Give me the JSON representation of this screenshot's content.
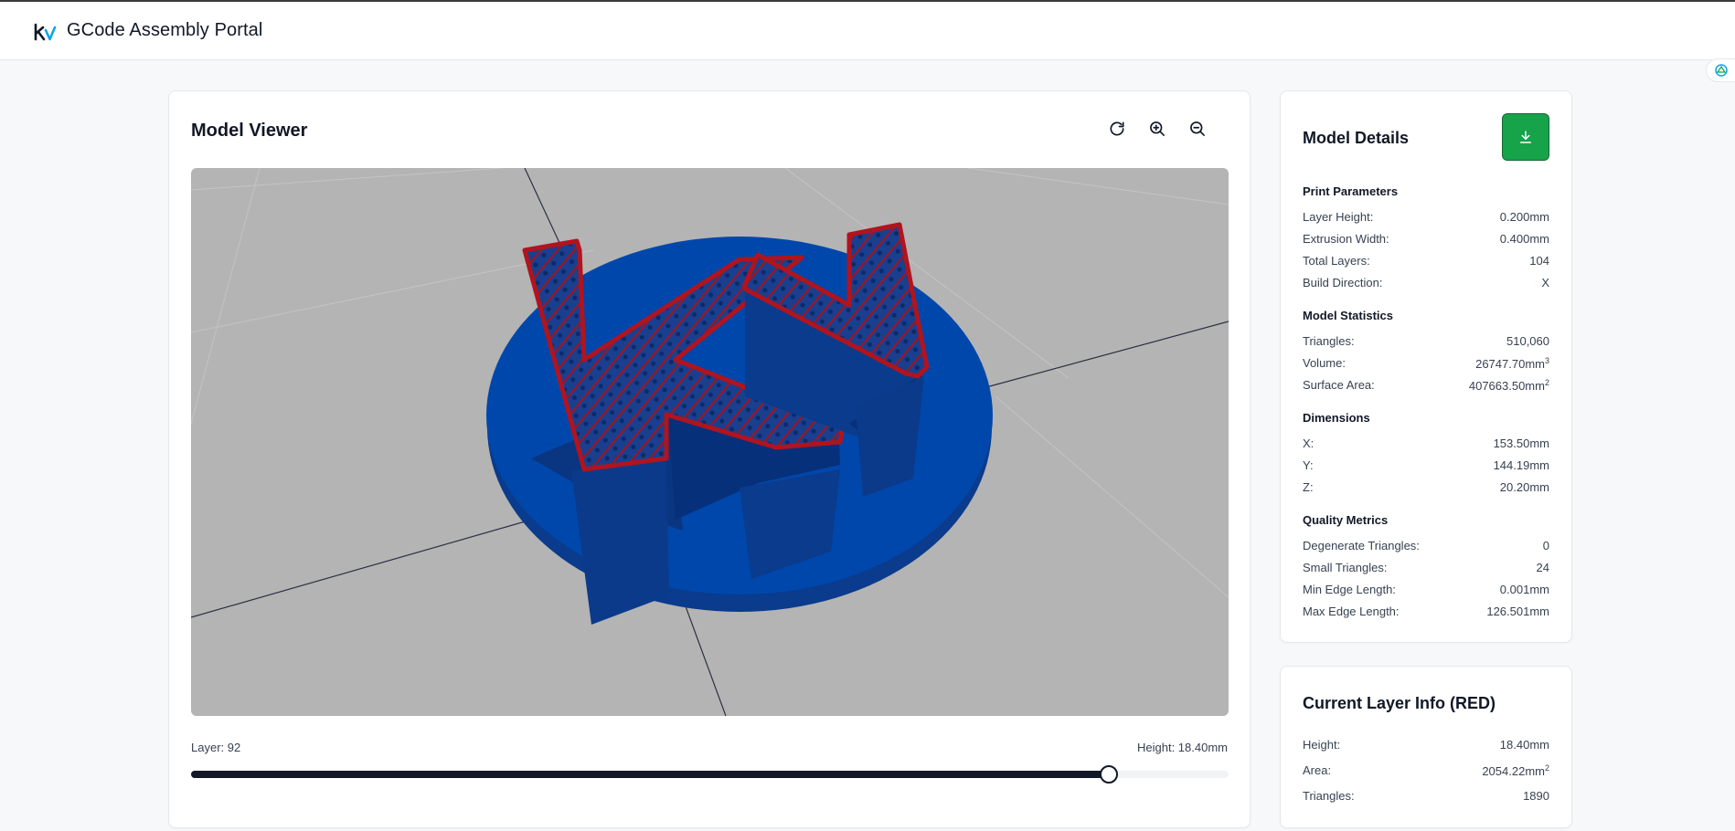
{
  "header": {
    "title": "GCode Assembly Portal",
    "logo_text": "kv"
  },
  "viewer": {
    "title": "Model Viewer",
    "tools": [
      {
        "name": "reset-view",
        "icon": "refresh-icon"
      },
      {
        "name": "zoom-in",
        "icon": "zoom-in-icon"
      },
      {
        "name": "zoom-out",
        "icon": "zoom-out-icon"
      }
    ],
    "layer_label": "Layer: 92",
    "height_label": "Height: 18.40mm",
    "slider": {
      "current_layer": 92,
      "total_layers": 104,
      "fraction": 0.885
    },
    "colors": {
      "viewport_bg": "#b4b4b4",
      "model": "#0047ab",
      "current_layer": "#b0141e"
    }
  },
  "details": {
    "title": "Model Details",
    "download_icon": "download-icon",
    "download_color": "#16a34a",
    "sections": [
      {
        "title": "Print Parameters",
        "rows": [
          {
            "label": "Layer Height:",
            "value": "0.200mm"
          },
          {
            "label": "Extrusion Width:",
            "value": "0.400mm"
          },
          {
            "label": "Total Layers:",
            "value": "104"
          },
          {
            "label": "Build Direction:",
            "value": "X"
          }
        ]
      },
      {
        "title": "Model Statistics",
        "rows": [
          {
            "label": "Triangles:",
            "value": "510,060"
          },
          {
            "label": "Volume:",
            "value": "26747.70mm",
            "unit_sup": "3"
          },
          {
            "label": "Surface Area:",
            "value": "407663.50mm",
            "unit_sup": "2"
          }
        ]
      },
      {
        "title": "Dimensions",
        "rows": [
          {
            "label": "X:",
            "value": "153.50mm"
          },
          {
            "label": "Y:",
            "value": "144.19mm"
          },
          {
            "label": "Z:",
            "value": "20.20mm"
          }
        ]
      },
      {
        "title": "Quality Metrics",
        "rows": [
          {
            "label": "Degenerate Triangles:",
            "value": "0"
          },
          {
            "label": "Small Triangles:",
            "value": "24"
          },
          {
            "label": "Min Edge Length:",
            "value": "0.001mm"
          },
          {
            "label": "Max Edge Length:",
            "value": "126.501mm"
          }
        ]
      }
    ]
  },
  "current_layer": {
    "title": "Current Layer Info (RED)",
    "rows": [
      {
        "label": "Height:",
        "value": "18.40mm"
      },
      {
        "label": "Area:",
        "value": "2054.22mm",
        "unit_sup": "2"
      },
      {
        "label": "Triangles:",
        "value": "1890"
      }
    ]
  }
}
